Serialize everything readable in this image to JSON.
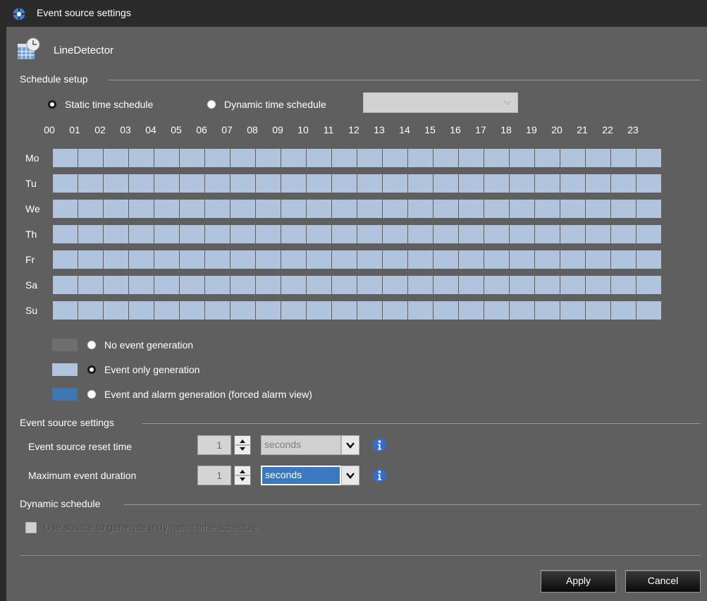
{
  "window": {
    "title": "Event source settings",
    "source_name": "LineDetector"
  },
  "schedule": {
    "section_label": "Schedule setup",
    "static_label": "Static time schedule",
    "dynamic_label": "Dynamic time schedule",
    "selected_mode": "static",
    "dynamic_combo_value": "",
    "hours": [
      "00",
      "01",
      "02",
      "03",
      "04",
      "05",
      "06",
      "07",
      "08",
      "09",
      "10",
      "11",
      "12",
      "13",
      "14",
      "15",
      "16",
      "17",
      "18",
      "19",
      "20",
      "21",
      "22",
      "23"
    ],
    "days": [
      "Mo",
      "Tu",
      "We",
      "Th",
      "Fr",
      "Sa",
      "Su"
    ],
    "cell_state": "event_only"
  },
  "legend": [
    {
      "label": "No event generation",
      "color": "#6e6e6e",
      "selected": false
    },
    {
      "label": "Event only generation",
      "color": "#b0c4de",
      "selected": true
    },
    {
      "label": "Event and alarm generation (forced alarm view)",
      "color": "#3f77b4",
      "selected": false
    }
  ],
  "event_settings": {
    "section_label": "Event source settings",
    "reset_time": {
      "label": "Event source reset time",
      "value": "1",
      "unit": "seconds"
    },
    "max_duration": {
      "label": "Maximum event duration",
      "value": "1",
      "unit": "seconds"
    }
  },
  "dynamic": {
    "section_label": "Dynamic schedule",
    "checkbox_label": "Use source to generate a dynamic time schedule",
    "checked": false
  },
  "buttons": {
    "apply": "Apply",
    "cancel": "Cancel"
  },
  "colors": {
    "background": "#5f5f5f",
    "titlebar": "#2b2b2b",
    "cell": "#b0c4de",
    "accent": "#3b78c0"
  }
}
